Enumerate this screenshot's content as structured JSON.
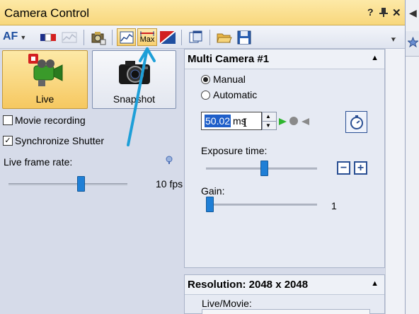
{
  "window": {
    "title": "Camera Control",
    "help": "?",
    "pin": "✕",
    "close": "✕"
  },
  "toolbar": {
    "af_label": "AF",
    "max_label": "Max"
  },
  "left": {
    "live_label": "Live",
    "snapshot_label": "Snapshot",
    "movie_recording": "Movie recording",
    "sync_shutter": "Synchronize Shutter",
    "live_frame_rate": "Live frame rate:",
    "fps_value": "10 fps",
    "fps_slider_level": 0.62
  },
  "multi_camera": {
    "title": "Multi Camera #1",
    "manual": "Manual",
    "automatic": "Automatic",
    "exposure_value": "50.02",
    "exposure_unit": "ms",
    "exposure_time_label": "Exposure time:",
    "exposure_slider_level": 0.53,
    "gain_label": "Gain:",
    "gain_value": "1",
    "gain_slider_level": 0.0
  },
  "resolution": {
    "title": "Resolution: 2048 x 2048",
    "live_movie_label": "Live/Movie:"
  },
  "colors": {
    "accent": "#f8d77c",
    "annotation_arrow": "#1e9fd8"
  }
}
